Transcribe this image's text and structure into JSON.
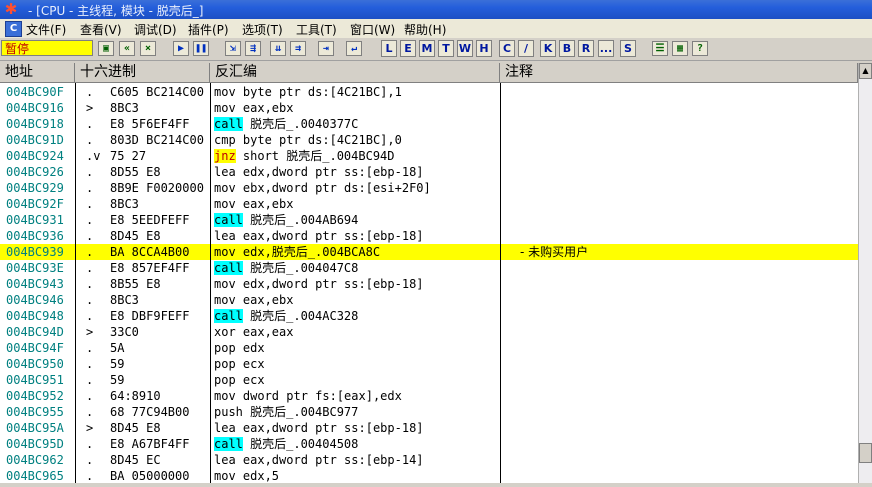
{
  "window": {
    "title": "- [CPU - 主线程, 模块 - 脱壳后_]"
  },
  "menu": {
    "items": [
      "文件(F)",
      "查看(V)",
      "调试(D)",
      "插件(P)",
      "选项(T)",
      "工具(T)",
      "窗口(W)",
      "帮助(H)"
    ]
  },
  "toolbar": {
    "status": "暂停",
    "letters": [
      "L",
      "E",
      "M",
      "T",
      "W",
      "H",
      "C",
      "/",
      "K",
      "B",
      "R",
      "...",
      "S"
    ]
  },
  "columns": {
    "address": "地址",
    "hex": "十六进制",
    "disasm": "反汇编",
    "comment": "注释"
  },
  "rows": [
    {
      "addr": "004BC90F",
      "mark": ".",
      "hex": "C605 BC214C00",
      "disasm": "mov byte ptr ds:[4C21BC],1",
      "hl": "",
      "comment": ""
    },
    {
      "addr": "004BC916",
      "mark": ">",
      "hex": "8BC3",
      "disasm": "mov eax,ebx",
      "hl": "",
      "comment": ""
    },
    {
      "addr": "004BC918",
      "mark": ".",
      "hex": "E8 5F6EF4FF",
      "disasm": "call 脱壳后_.0040377C",
      "hl": "call",
      "comment": ""
    },
    {
      "addr": "004BC91D",
      "mark": ".",
      "hex": "803D BC214C00",
      "disasm": "cmp byte ptr ds:[4C21BC],0",
      "hl": "",
      "comment": ""
    },
    {
      "addr": "004BC924",
      "mark": ".v",
      "hex": "75 27",
      "disasm": "jnz short 脱壳后_.004BC94D",
      "hl": "jnz",
      "comment": ""
    },
    {
      "addr": "004BC926",
      "mark": ".",
      "hex": "8D55 E8",
      "disasm": "lea edx,dword ptr ss:[ebp-18]",
      "hl": "",
      "comment": ""
    },
    {
      "addr": "004BC929",
      "mark": ".",
      "hex": "8B9E F0020000",
      "disasm": "mov ebx,dword ptr ds:[esi+2F0]",
      "hl": "",
      "comment": ""
    },
    {
      "addr": "004BC92F",
      "mark": ".",
      "hex": "8BC3",
      "disasm": "mov eax,ebx",
      "hl": "",
      "comment": ""
    },
    {
      "addr": "004BC931",
      "mark": ".",
      "hex": "E8 5EEDFEFF",
      "disasm": "call 脱壳后_.004AB694",
      "hl": "call",
      "comment": ""
    },
    {
      "addr": "004BC936",
      "mark": ".",
      "hex": "8D45 E8",
      "disasm": "lea eax,dword ptr ss:[ebp-18]",
      "hl": "",
      "comment": ""
    },
    {
      "addr": "004BC939",
      "mark": ".",
      "hex": "BA 8CCA4B00",
      "disasm": "mov edx,脱壳后_.004BCA8C",
      "hl": "",
      "comment": "- 未购买用户",
      "selected": true
    },
    {
      "addr": "004BC93E",
      "mark": ".",
      "hex": "E8 857EF4FF",
      "disasm": "call 脱壳后_.004047C8",
      "hl": "call",
      "comment": ""
    },
    {
      "addr": "004BC943",
      "mark": ".",
      "hex": "8B55 E8",
      "disasm": "mov edx,dword ptr ss:[ebp-18]",
      "hl": "",
      "comment": ""
    },
    {
      "addr": "004BC946",
      "mark": ".",
      "hex": "8BC3",
      "disasm": "mov eax,ebx",
      "hl": "",
      "comment": ""
    },
    {
      "addr": "004BC948",
      "mark": ".",
      "hex": "E8 DBF9FEFF",
      "disasm": "call 脱壳后_.004AC328",
      "hl": "call",
      "comment": ""
    },
    {
      "addr": "004BC94D",
      "mark": ">",
      "hex": "33C0",
      "disasm": "xor eax,eax",
      "hl": "",
      "comment": ""
    },
    {
      "addr": "004BC94F",
      "mark": ".",
      "hex": "5A",
      "disasm": "pop edx",
      "hl": "",
      "comment": ""
    },
    {
      "addr": "004BC950",
      "mark": ".",
      "hex": "59",
      "disasm": "pop ecx",
      "hl": "",
      "comment": ""
    },
    {
      "addr": "004BC951",
      "mark": ".",
      "hex": "59",
      "disasm": "pop ecx",
      "hl": "",
      "comment": ""
    },
    {
      "addr": "004BC952",
      "mark": ".",
      "hex": "64:8910",
      "disasm": "mov dword ptr fs:[eax],edx",
      "hl": "",
      "comment": ""
    },
    {
      "addr": "004BC955",
      "mark": ".",
      "hex": "68 77C94B00",
      "disasm": "push 脱壳后_.004BC977",
      "hl": "",
      "comment": ""
    },
    {
      "addr": "004BC95A",
      "mark": ">",
      "hex": "8D45 E8",
      "disasm": "lea eax,dword ptr ss:[ebp-18]",
      "hl": "",
      "comment": ""
    },
    {
      "addr": "004BC95D",
      "mark": ".",
      "hex": "E8 A67BF4FF",
      "disasm": "call 脱壳后_.00404508",
      "hl": "call",
      "comment": ""
    },
    {
      "addr": "004BC962",
      "mark": ".",
      "hex": "8D45 EC",
      "disasm": "lea eax,dword ptr ss:[ebp-14]",
      "hl": "",
      "comment": ""
    },
    {
      "addr": "004BC965",
      "mark": ".",
      "hex": "BA 05000000",
      "disasm": "mov edx,5",
      "hl": "",
      "comment": ""
    }
  ]
}
